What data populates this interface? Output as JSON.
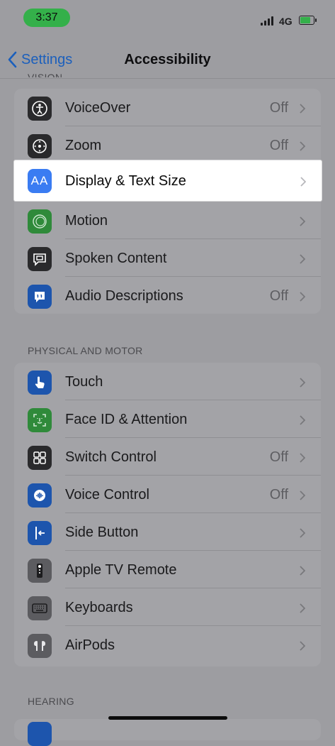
{
  "status": {
    "time": "3:37",
    "network": "4G"
  },
  "nav": {
    "back_label": "Settings",
    "title": "Accessibility"
  },
  "sections": {
    "vision_header": "VISION",
    "physical_header": "PHYSICAL AND MOTOR",
    "hearing_header": "HEARING"
  },
  "vision_items": [
    {
      "label": "VoiceOver",
      "value": "Off",
      "icon": "voiceover-icon"
    },
    {
      "label": "Zoom",
      "value": "Off",
      "icon": "zoom-icon"
    },
    {
      "label": "Display & Text Size",
      "value": "",
      "icon": "text-size-icon",
      "icon_text": "AA"
    },
    {
      "label": "Motion",
      "value": "",
      "icon": "motion-icon"
    },
    {
      "label": "Spoken Content",
      "value": "",
      "icon": "spoken-content-icon"
    },
    {
      "label": "Audio Descriptions",
      "value": "Off",
      "icon": "audio-descriptions-icon"
    }
  ],
  "physical_items": [
    {
      "label": "Touch",
      "value": "",
      "icon": "touch-icon"
    },
    {
      "label": "Face ID & Attention",
      "value": "",
      "icon": "face-id-icon"
    },
    {
      "label": "Switch Control",
      "value": "Off",
      "icon": "switch-control-icon"
    },
    {
      "label": "Voice Control",
      "value": "Off",
      "icon": "voice-control-icon"
    },
    {
      "label": "Side Button",
      "value": "",
      "icon": "side-button-icon"
    },
    {
      "label": "Apple TV Remote",
      "value": "",
      "icon": "tv-remote-icon"
    },
    {
      "label": "Keyboards",
      "value": "",
      "icon": "keyboard-icon"
    },
    {
      "label": "AirPods",
      "value": "",
      "icon": "airpods-icon"
    }
  ],
  "colors": {
    "accent": "#1b5fbc",
    "highlight_icon": "#3a7cf2",
    "time_pill": "#34b04a"
  },
  "battery_level": 0.8
}
